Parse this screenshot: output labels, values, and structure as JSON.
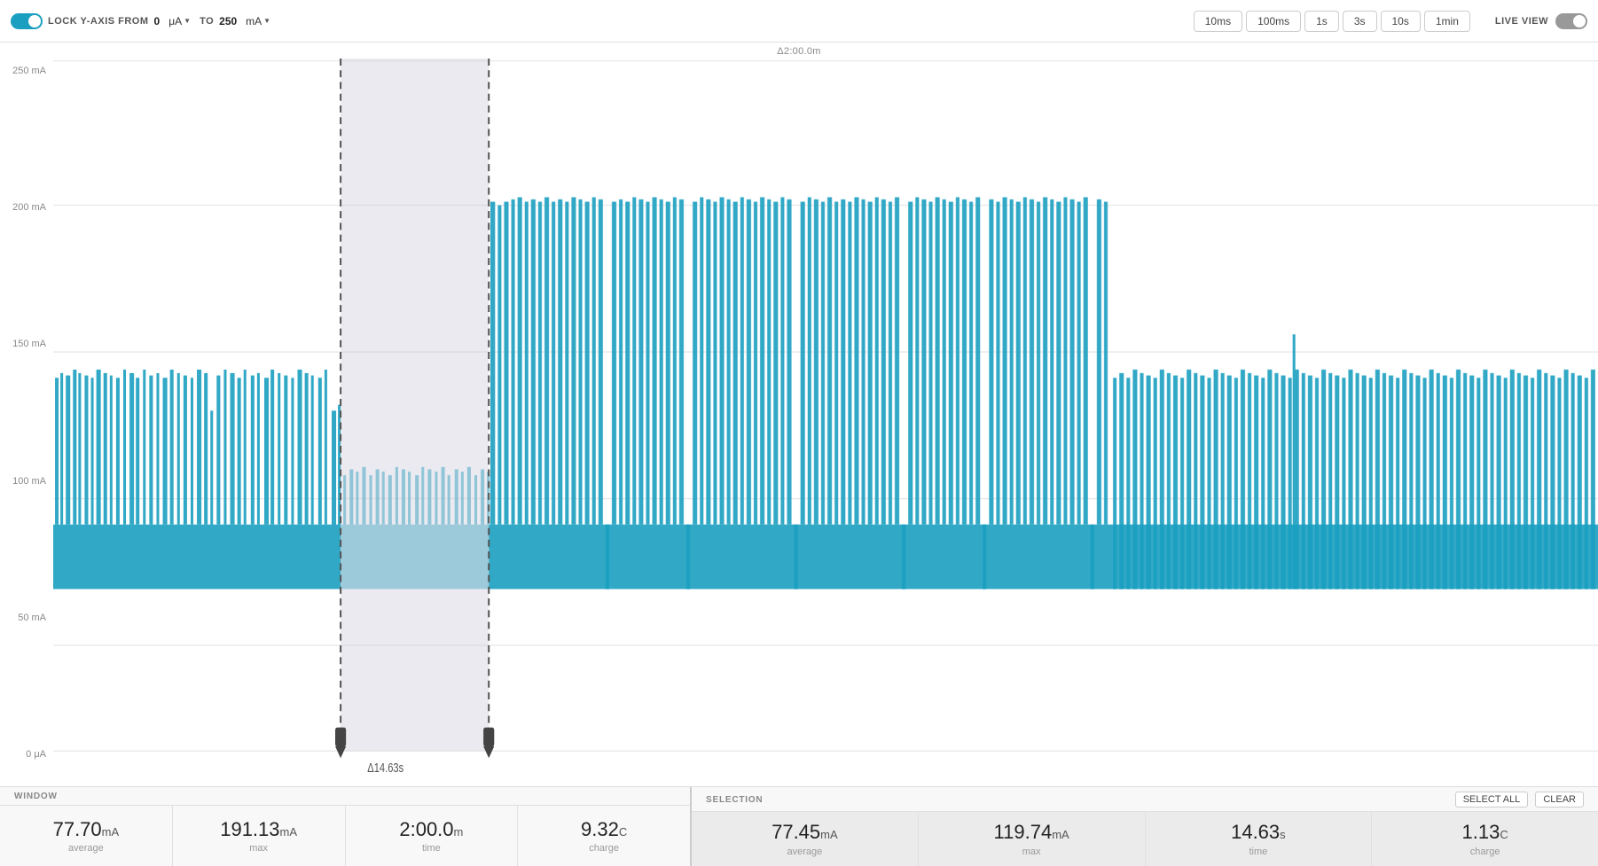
{
  "toolbar": {
    "lock_label": "LOCK Y-AXIS FROM",
    "from_value": "0",
    "from_unit": "μA",
    "to_label": "TO",
    "to_value": "250",
    "to_unit": "mA",
    "time_buttons": [
      "10ms",
      "100ms",
      "1s",
      "3s",
      "10s",
      "1min"
    ],
    "live_view_label": "LIVE VIEW"
  },
  "chart": {
    "delta_label": "Δ2:00.0m",
    "y_labels": [
      "250 mA",
      "200 mA",
      "150 mA",
      "100 mA",
      "50 mA",
      "0 μA"
    ],
    "selection_delta": "Δ14.63s",
    "cursor_left": "Δ14.63s"
  },
  "window_stats": {
    "section_label": "WINDOW",
    "average_value": "77.70",
    "average_unit": "mA",
    "average_sub": "average",
    "max_value": "191.13",
    "max_unit": "mA",
    "max_sub": "max",
    "time_value": "2:00.0",
    "time_unit": "m",
    "time_sub": "time",
    "charge_value": "9.32",
    "charge_unit": "C",
    "charge_sub": "charge"
  },
  "selection_stats": {
    "section_label": "SELECTION",
    "select_all": "SELECT ALL",
    "clear": "CLEAR",
    "average_value": "77.45",
    "average_unit": "mA",
    "average_sub": "average",
    "max_value": "119.74",
    "max_unit": "mA",
    "max_sub": "max",
    "time_value": "14.63",
    "time_unit": "s",
    "time_sub": "time",
    "charge_value": "1.13",
    "charge_unit": "C",
    "charge_sub": "charge"
  }
}
